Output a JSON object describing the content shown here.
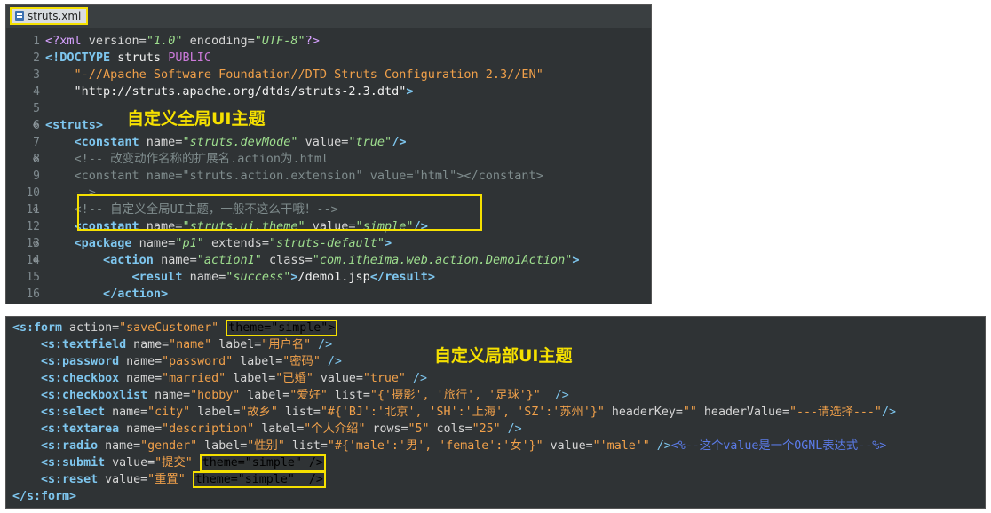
{
  "tab": {
    "file_name": "struts.xml"
  },
  "annotations": {
    "global_theme": "自定义全局UI主题",
    "local_theme": "自定义局部UI主题"
  },
  "xml_lines": [
    {
      "num": "1",
      "fold": "",
      "segs": [
        [
          "pi",
          "<?xml "
        ],
        [
          "att",
          "version="
        ],
        [
          "str",
          "\"1.0\""
        ],
        [
          "att",
          " encoding="
        ],
        [
          "str",
          "\"UTF-8\""
        ],
        [
          "pi",
          "?>"
        ]
      ]
    },
    {
      "num": "2",
      "fold": "",
      "segs": [
        [
          "tag",
          "<!DOCTYPE"
        ],
        [
          "wht",
          " struts "
        ],
        [
          "kw",
          "PUBLIC"
        ]
      ]
    },
    {
      "num": "3",
      "fold": "",
      "segs": [
        [
          "pun",
          "    "
        ],
        [
          "dstr",
          "\"-//Apache Software Foundation//DTD Struts Configuration 2.3//EN\""
        ]
      ]
    },
    {
      "num": "4",
      "fold": "",
      "segs": [
        [
          "pun",
          "    "
        ],
        [
          "wht",
          "\"http://struts.apache.org/dtds/struts-2.3.dtd\""
        ],
        [
          "tag",
          ">"
        ]
      ]
    },
    {
      "num": "5",
      "fold": "",
      "segs": []
    },
    {
      "num": "6",
      "fold": "⊖",
      "segs": [
        [
          "tag",
          "<struts>"
        ]
      ]
    },
    {
      "num": "7",
      "fold": "",
      "segs": [
        [
          "pun",
          "    "
        ],
        [
          "tag",
          "<constant"
        ],
        [
          "att",
          " name="
        ],
        [
          "str",
          "\"struts.devMode\""
        ],
        [
          "att",
          " value="
        ],
        [
          "str",
          "\"true\""
        ],
        [
          "tag",
          "/>"
        ]
      ]
    },
    {
      "num": "8",
      "fold": "⊖",
      "segs": [
        [
          "pun",
          "    "
        ],
        [
          "com",
          "<!-- 改变动作名称的扩展名.action为.html"
        ]
      ]
    },
    {
      "num": "9",
      "fold": "",
      "segs": [
        [
          "pun",
          "    "
        ],
        [
          "com",
          "<constant name=\"struts.action.extension\" value=\"html\"></constant>"
        ]
      ]
    },
    {
      "num": "10",
      "fold": "",
      "segs": [
        [
          "pun",
          "    "
        ],
        [
          "com",
          "-->"
        ]
      ]
    },
    {
      "num": "11",
      "fold": "⊖",
      "segs": [
        [
          "pun",
          "    "
        ],
        [
          "com",
          "<!-- 自定义全局UI主题，一般不这么干哦！-->"
        ]
      ]
    },
    {
      "num": "12",
      "fold": "",
      "segs": [
        [
          "pun",
          "    "
        ],
        [
          "tag",
          "<constant"
        ],
        [
          "att",
          " name="
        ],
        [
          "str",
          "\"struts.ui.theme\""
        ],
        [
          "att",
          " value="
        ],
        [
          "str",
          "\"simple\""
        ],
        [
          "tag",
          "/>"
        ]
      ]
    },
    {
      "num": "13",
      "fold": "⊖",
      "segs": [
        [
          "pun",
          "    "
        ],
        [
          "tag",
          "<package"
        ],
        [
          "att",
          " name="
        ],
        [
          "str",
          "\"p1\""
        ],
        [
          "att",
          " extends="
        ],
        [
          "str",
          "\"struts-default\""
        ],
        [
          "tag",
          ">"
        ]
      ]
    },
    {
      "num": "14",
      "fold": "⊖",
      "segs": [
        [
          "pun",
          "        "
        ],
        [
          "tag",
          "<action"
        ],
        [
          "att",
          " name="
        ],
        [
          "str",
          "\"action1\""
        ],
        [
          "att",
          " class="
        ],
        [
          "str",
          "\"com.itheima.web.action.Demo1Action\""
        ],
        [
          "tag",
          ">"
        ]
      ]
    },
    {
      "num": "15",
      "fold": "",
      "segs": [
        [
          "pun",
          "            "
        ],
        [
          "tag",
          "<result"
        ],
        [
          "att",
          " name="
        ],
        [
          "str",
          "\"success\""
        ],
        [
          "tag",
          ">"
        ],
        [
          "wht",
          "/demo1.jsp"
        ],
        [
          "tag",
          "</result>"
        ]
      ]
    },
    {
      "num": "16",
      "fold": "",
      "segs": [
        [
          "pun",
          "        "
        ],
        [
          "tag",
          "</action>"
        ]
      ]
    }
  ],
  "jsp_lines": [
    {
      "segs": [
        [
          "tag",
          "<s:form"
        ],
        [
          "att",
          " action="
        ],
        [
          "dstr",
          "\"saveCustomer\""
        ],
        [
          "pun",
          " "
        ],
        [
          "hl",
          "theme=\"simple\">"
        ]
      ]
    },
    {
      "segs": [
        [
          "pun",
          "    "
        ],
        [
          "tag",
          "<s:textfield"
        ],
        [
          "att",
          " name="
        ],
        [
          "dstr",
          "\"name\""
        ],
        [
          "att",
          " label="
        ],
        [
          "dstr",
          "\"用户名\""
        ],
        [
          "blue",
          " />"
        ]
      ]
    },
    {
      "segs": [
        [
          "pun",
          "    "
        ],
        [
          "tag",
          "<s:password"
        ],
        [
          "att",
          " name="
        ],
        [
          "dstr",
          "\"password\""
        ],
        [
          "att",
          " label="
        ],
        [
          "dstr",
          "\"密码\""
        ],
        [
          "blue",
          " />"
        ]
      ]
    },
    {
      "segs": [
        [
          "pun",
          "    "
        ],
        [
          "tag",
          "<s:checkbox"
        ],
        [
          "att",
          " name="
        ],
        [
          "dstr",
          "\"married\""
        ],
        [
          "att",
          " label="
        ],
        [
          "dstr",
          "\"已婚\""
        ],
        [
          "att",
          " value="
        ],
        [
          "dstr",
          "\"true\""
        ],
        [
          "blue",
          " />"
        ]
      ]
    },
    {
      "segs": [
        [
          "pun",
          "    "
        ],
        [
          "tag",
          "<s:checkboxlist"
        ],
        [
          "att",
          " name="
        ],
        [
          "dstr",
          "\"hobby\""
        ],
        [
          "att",
          " label="
        ],
        [
          "dstr",
          "\"爱好\""
        ],
        [
          "att",
          " list="
        ],
        [
          "dstr",
          "\"{'摄影', '旅行', '足球'}\""
        ],
        [
          "blue",
          "  />"
        ]
      ]
    },
    {
      "segs": [
        [
          "pun",
          "    "
        ],
        [
          "tag",
          "<s:select"
        ],
        [
          "att",
          " name="
        ],
        [
          "dstr",
          "\"city\""
        ],
        [
          "att",
          " label="
        ],
        [
          "dstr",
          "\"故乡\""
        ],
        [
          "att",
          " list="
        ],
        [
          "dstr",
          "\"#{'BJ':'北京', 'SH':'上海', 'SZ':'苏州'}\""
        ],
        [
          "att",
          " headerKey="
        ],
        [
          "dstr",
          "\"\""
        ],
        [
          "att",
          " headerValue="
        ],
        [
          "dstr",
          "\"---请选择---\""
        ],
        [
          "blue",
          "/>"
        ]
      ]
    },
    {
      "segs": [
        [
          "pun",
          "    "
        ],
        [
          "tag",
          "<s:textarea"
        ],
        [
          "att",
          " name="
        ],
        [
          "dstr",
          "\"description\""
        ],
        [
          "att",
          " label="
        ],
        [
          "dstr",
          "\"个人介绍\""
        ],
        [
          "att",
          " rows="
        ],
        [
          "dstr",
          "\"5\""
        ],
        [
          "att",
          " cols="
        ],
        [
          "dstr",
          "\"25\""
        ],
        [
          "blue",
          " />"
        ]
      ]
    },
    {
      "segs": [
        [
          "pun",
          "    "
        ],
        [
          "tag",
          "<s:radio"
        ],
        [
          "att",
          " name="
        ],
        [
          "dstr",
          "\"gender\""
        ],
        [
          "att",
          " label="
        ],
        [
          "dstr",
          "\"性别\""
        ],
        [
          "att",
          " list="
        ],
        [
          "dstr",
          "\"#{'male':'男', 'female':'女'}\""
        ],
        [
          "att",
          " value="
        ],
        [
          "dstr",
          "\"'male'\""
        ],
        [
          "blue",
          " />"
        ],
        [
          "ognl",
          "<%--这个value是一个OGNL表达式--%>"
        ]
      ]
    },
    {
      "segs": [
        [
          "pun",
          "    "
        ],
        [
          "tag",
          "<s:submit"
        ],
        [
          "att",
          " value="
        ],
        [
          "dstr",
          "\"提交\""
        ],
        [
          "pun",
          " "
        ],
        [
          "hl",
          "theme=\"simple\" />"
        ]
      ]
    },
    {
      "segs": [
        [
          "pun",
          "    "
        ],
        [
          "tag",
          "<s:reset"
        ],
        [
          "att",
          " value="
        ],
        [
          "dstr",
          "\"重置\""
        ],
        [
          "pun",
          " "
        ],
        [
          "hl",
          "theme=\"simple\"  />"
        ]
      ]
    },
    {
      "segs": [
        [
          "tag",
          "</s:form>"
        ]
      ]
    }
  ]
}
